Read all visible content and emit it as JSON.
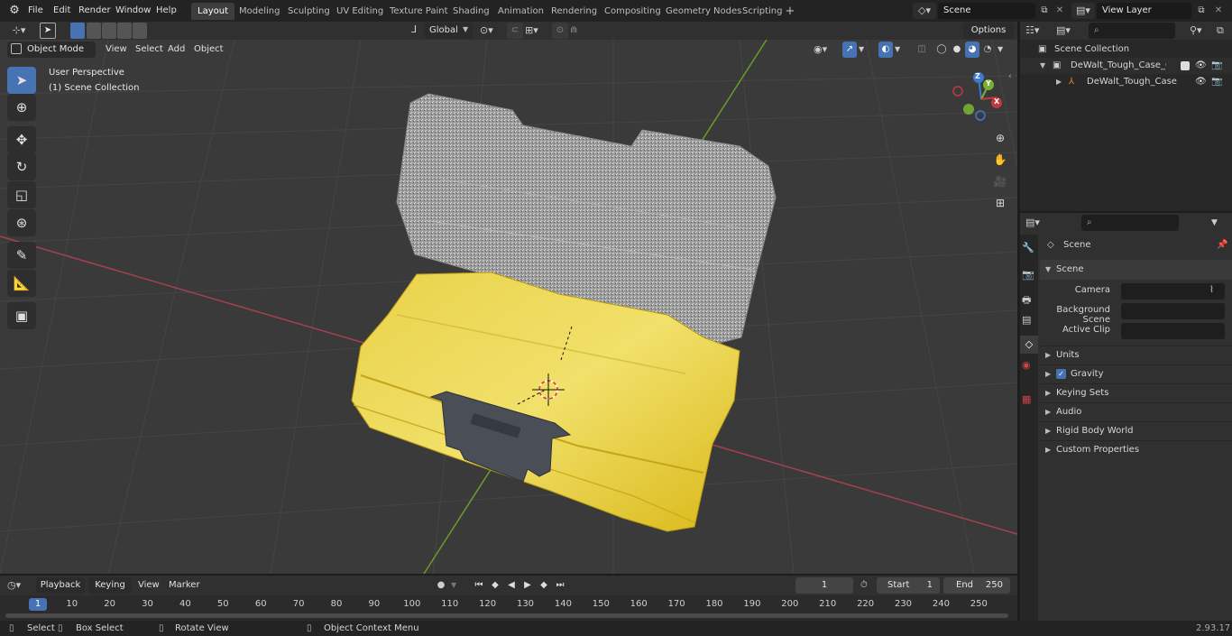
{
  "menubar": {
    "items": [
      "File",
      "Edit",
      "Render",
      "Window",
      "Help"
    ],
    "workspaces": [
      "Layout",
      "Modeling",
      "Sculpting",
      "UV Editing",
      "Texture Paint",
      "Shading",
      "Animation",
      "Rendering",
      "Compositing",
      "Geometry Nodes",
      "Scripting"
    ],
    "active_workspace": "Layout",
    "add_tab": "+",
    "scene_value": "Scene",
    "view_layer_value": "View Layer"
  },
  "viewport_header": {
    "mode": "Object Mode",
    "menu": [
      "View",
      "Select",
      "Add",
      "Object"
    ],
    "orientation": "Global",
    "options": "Options"
  },
  "viewport": {
    "perspective": "User Perspective",
    "collection": "(1) Scene Collection",
    "gizmo_axes": [
      "Z",
      "Y",
      "X"
    ]
  },
  "outliner": {
    "root": "Scene Collection",
    "items": [
      {
        "label": "DeWalt_Tough_Case_Organiz"
      },
      {
        "label": "DeWalt_Tough_Case_Org"
      }
    ]
  },
  "properties": {
    "context": "Scene",
    "section": "Scene",
    "fields": [
      {
        "label": "Camera",
        "value": ""
      },
      {
        "label": "Background Scene",
        "value": ""
      },
      {
        "label": "Active Clip",
        "value": ""
      }
    ],
    "panels": [
      "Units",
      "Gravity",
      "Keying Sets",
      "Audio",
      "Rigid Body World",
      "Custom Properties"
    ]
  },
  "timeline": {
    "menu": [
      "Playback",
      "Keying",
      "View",
      "Marker"
    ],
    "current_frame": "1",
    "start_label": "Start",
    "start_value": "1",
    "end_label": "End",
    "end_value": "250",
    "ticks": [
      "1",
      "10",
      "20",
      "30",
      "40",
      "50",
      "60",
      "70",
      "80",
      "90",
      "100",
      "110",
      "120",
      "130",
      "140",
      "150",
      "160",
      "170",
      "180",
      "190",
      "200",
      "210",
      "220",
      "230",
      "240",
      "250"
    ]
  },
  "statusbar": {
    "items": [
      "Select",
      "Box Select",
      "Rotate View",
      "Object Context Menu"
    ],
    "version": "2.93.17"
  },
  "colors": {
    "accent": "#4772b3",
    "case_yellow": "#e8c92a",
    "x_axis": "#b03a48",
    "y_axis": "#6b9b2a"
  }
}
